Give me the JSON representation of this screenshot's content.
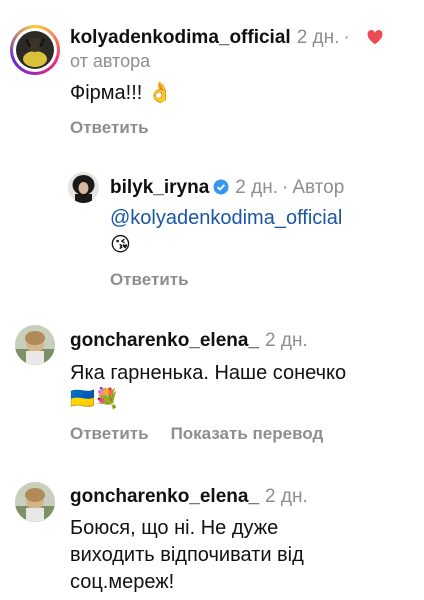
{
  "comments": [
    {
      "username": "kolyadenkodima_official",
      "time": "2 дн.",
      "subtitle": "от автора",
      "text": "Фірма!!!",
      "emoji": "👌",
      "reply_label": "Ответить",
      "liked_by_author": true
    },
    {
      "username": "bilyk_iryna",
      "verified": true,
      "time": "2 дн.",
      "separator": "·",
      "author_label": "Автор",
      "mention": "@kolyadenkodima_official",
      "emoji": "😘",
      "reply_label": "Ответить"
    },
    {
      "username": "goncharenko_elena_",
      "time": "2 дн.",
      "text": "Яка гарненька. Наше сонечко",
      "emoji": "🇺🇦💐",
      "reply_label": "Ответить",
      "translate_label": "Показать перевод"
    },
    {
      "username": "goncharenko_elena_",
      "time": "2 дн.",
      "text_lines": [
        "Боюся, що ні. Не дуже",
        "виходить відпочивати від",
        "соц.мереж!"
      ]
    }
  ],
  "colors": {
    "heart": "#ed4956",
    "verified": "#3897f0",
    "mention": "#1a56a8",
    "secondary": "#8e8e8e"
  }
}
